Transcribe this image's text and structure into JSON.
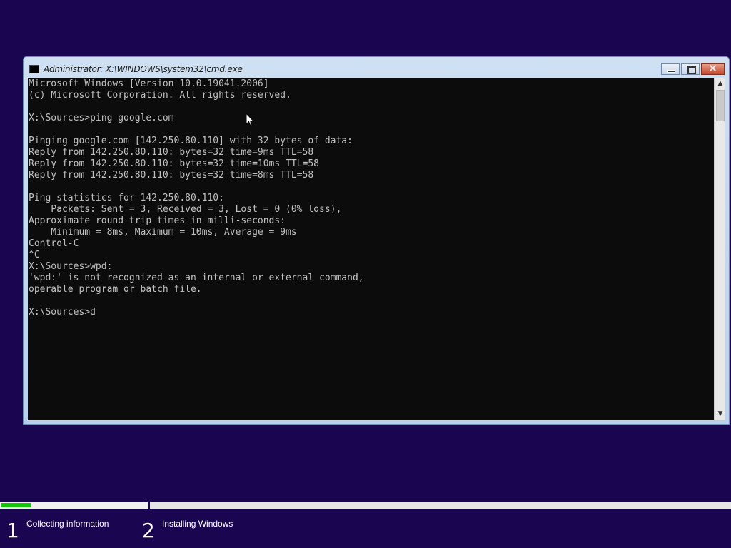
{
  "window": {
    "title": "Administrator: X:\\WINDOWS\\system32\\cmd.exe",
    "close_symbol": "✕"
  },
  "console": {
    "lines": [
      "Microsoft Windows [Version 10.0.19041.2006]",
      "(c) Microsoft Corporation. All rights reserved.",
      "",
      "X:\\Sources>ping google.com",
      "",
      "Pinging google.com [142.250.80.110] with 32 bytes of data:",
      "Reply from 142.250.80.110: bytes=32 time=9ms TTL=58",
      "Reply from 142.250.80.110: bytes=32 time=10ms TTL=58",
      "Reply from 142.250.80.110: bytes=32 time=8ms TTL=58",
      "",
      "Ping statistics for 142.250.80.110:",
      "    Packets: Sent = 3, Received = 3, Lost = 0 (0% loss),",
      "Approximate round trip times in milli-seconds:",
      "    Minimum = 8ms, Maximum = 10ms, Average = 9ms",
      "Control-C",
      "^C",
      "X:\\Sources>wpd:",
      "'wpd:' is not recognized as an internal or external command,",
      "operable program or batch file.",
      "",
      "X:\\Sources>d"
    ]
  },
  "setup": {
    "progress_fraction": 0.2,
    "steps": [
      {
        "number": "1",
        "label": "Collecting information"
      },
      {
        "number": "2",
        "label": "Installing Windows"
      }
    ]
  },
  "colors": {
    "background": "#1a0550",
    "console_bg": "#0c0c0c",
    "console_fg": "#c0c0c0",
    "progress": "#16c20c"
  },
  "icons": {
    "window_icon": "cmd-icon",
    "minimize": "minimize-icon",
    "maximize": "maximize-icon",
    "close": "close-icon",
    "scroll_up": "scroll-up-arrow-icon",
    "scroll_down": "scroll-down-arrow-icon",
    "cursor": "mouse-pointer-icon"
  }
}
